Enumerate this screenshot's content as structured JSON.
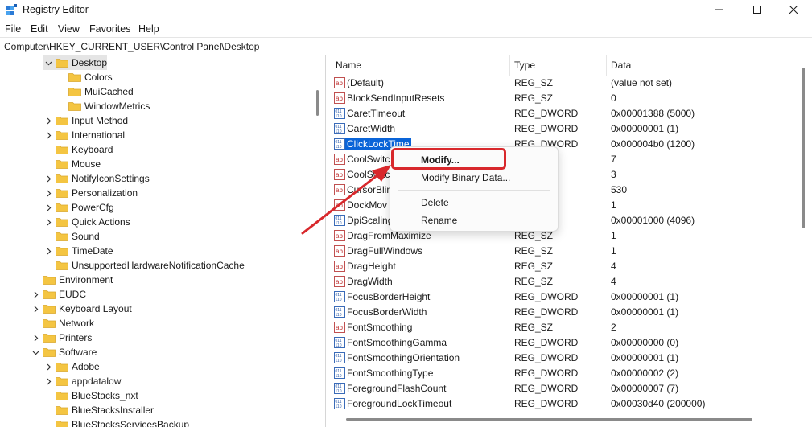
{
  "window": {
    "title": "Registry Editor",
    "minimize_glyph": "—",
    "maximize_glyph": "☐",
    "close_glyph": "✕"
  },
  "menu": [
    "File",
    "Edit",
    "View",
    "Favorites",
    "Help"
  ],
  "address": "Computer\\HKEY_CURRENT_USER\\Control Panel\\Desktop",
  "tree": [
    {
      "label": "Desktop",
      "chevron": "down",
      "selected": true
    },
    {
      "label": "Colors"
    },
    {
      "label": "MuiCached"
    },
    {
      "label": "WindowMetrics"
    },
    {
      "label": "Input Method",
      "chevron": "right"
    },
    {
      "label": "International",
      "chevron": "right"
    },
    {
      "label": "Keyboard"
    },
    {
      "label": "Mouse"
    },
    {
      "label": "NotifyIconSettings",
      "chevron": "right"
    },
    {
      "label": "Personalization",
      "chevron": "right"
    },
    {
      "label": "PowerCfg",
      "chevron": "right"
    },
    {
      "label": "Quick Actions",
      "chevron": "right"
    },
    {
      "label": "Sound"
    },
    {
      "label": "TimeDate",
      "chevron": "right"
    },
    {
      "label": "UnsupportedHardwareNotificationCache"
    },
    {
      "label": "Environment"
    },
    {
      "label": "EUDC",
      "chevron": "right"
    },
    {
      "label": "Keyboard Layout",
      "chevron": "right"
    },
    {
      "label": "Network"
    },
    {
      "label": "Printers",
      "chevron": "right"
    },
    {
      "label": "Software",
      "chevron": "down"
    },
    {
      "label": "Adobe",
      "chevron": "right"
    },
    {
      "label": "appdatalow",
      "chevron": "right"
    },
    {
      "label": "BlueStacks_nxt"
    },
    {
      "label": "BlueStacksInstaller"
    },
    {
      "label": "BlueStacksServicesBackup"
    }
  ],
  "columns": {
    "name": "Name",
    "type": "Type",
    "data": "Data"
  },
  "values": [
    {
      "icon": "ab",
      "name": "(Default)",
      "type": "REG_SZ",
      "data": "(value not set)"
    },
    {
      "icon": "ab",
      "name": "BlockSendInputResets",
      "type": "REG_SZ",
      "data": "0"
    },
    {
      "icon": "bin",
      "name": "CaretTimeout",
      "type": "REG_DWORD",
      "data": "0x00001388 (5000)"
    },
    {
      "icon": "bin",
      "name": "CaretWidth",
      "type": "REG_DWORD",
      "data": "0x00000001 (1)"
    },
    {
      "icon": "bin",
      "name": "ClickLockTime",
      "type": "REG_DWORD",
      "data": "0x000004b0 (1200)",
      "selected": true
    },
    {
      "icon": "ab",
      "name": "CoolSwitc",
      "type": "",
      "data": "7"
    },
    {
      "icon": "ab",
      "name": "CoolSwitc",
      "type": "",
      "data": "3"
    },
    {
      "icon": "ab",
      "name": "CursorBlin",
      "type": "",
      "data": "530"
    },
    {
      "icon": "ab",
      "name": "DockMov",
      "type": "",
      "data": "1"
    },
    {
      "icon": "bin",
      "name": "DpiScaling",
      "type": "RD",
      "data": "0x00001000 (4096)"
    },
    {
      "icon": "ab",
      "name": "DragFromMaximize",
      "type": "REG_SZ",
      "data": "1"
    },
    {
      "icon": "ab",
      "name": "DragFullWindows",
      "type": "REG_SZ",
      "data": "1"
    },
    {
      "icon": "ab",
      "name": "DragHeight",
      "type": "REG_SZ",
      "data": "4"
    },
    {
      "icon": "ab",
      "name": "DragWidth",
      "type": "REG_SZ",
      "data": "4"
    },
    {
      "icon": "bin",
      "name": "FocusBorderHeight",
      "type": "REG_DWORD",
      "data": "0x00000001 (1)"
    },
    {
      "icon": "bin",
      "name": "FocusBorderWidth",
      "type": "REG_DWORD",
      "data": "0x00000001 (1)"
    },
    {
      "icon": "ab",
      "name": "FontSmoothing",
      "type": "REG_SZ",
      "data": "2"
    },
    {
      "icon": "bin",
      "name": "FontSmoothingGamma",
      "type": "REG_DWORD",
      "data": "0x00000000 (0)"
    },
    {
      "icon": "bin",
      "name": "FontSmoothingOrientation",
      "type": "REG_DWORD",
      "data": "0x00000001 (1)"
    },
    {
      "icon": "bin",
      "name": "FontSmoothingType",
      "type": "REG_DWORD",
      "data": "0x00000002 (2)"
    },
    {
      "icon": "bin",
      "name": "ForegroundFlashCount",
      "type": "REG_DWORD",
      "data": "0x00000007 (7)"
    },
    {
      "icon": "bin",
      "name": "ForegroundLockTimeout",
      "type": "REG_DWORD",
      "data": "0x00030d40 (200000)"
    }
  ],
  "icon_text": {
    "ab": "ab",
    "bin": "011"
  },
  "context_menu": {
    "items": [
      "Modify...",
      "Modify Binary Data...",
      "Delete",
      "Rename"
    ]
  },
  "colors": {
    "selection": "#0a64d8",
    "highlight": "#d8282c",
    "folder": "#f4c542"
  }
}
